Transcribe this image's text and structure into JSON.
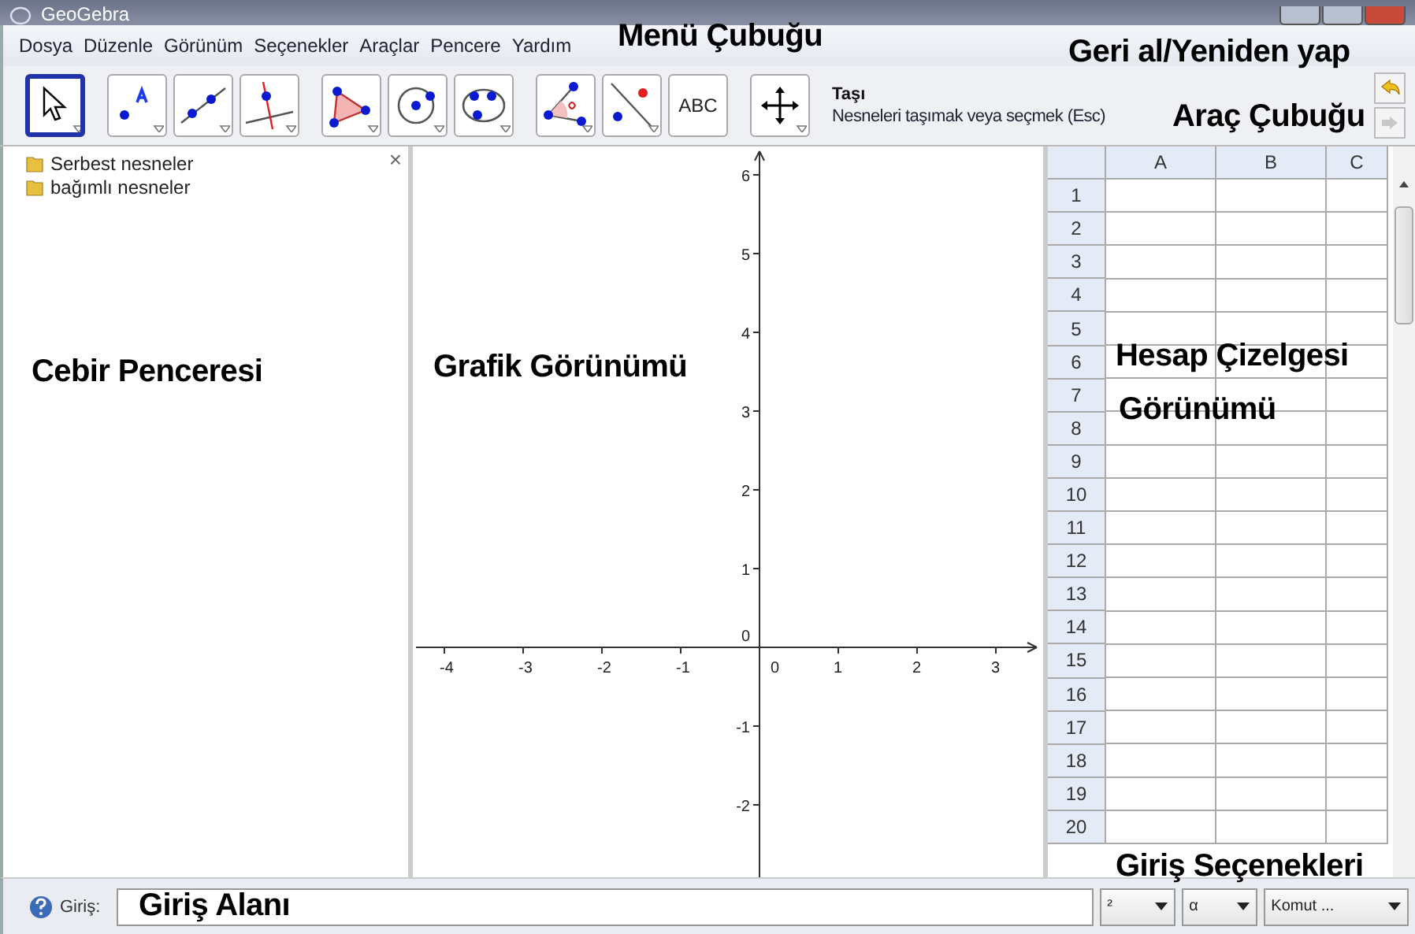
{
  "window": {
    "title": "GeoGebra"
  },
  "menu": [
    "Dosya",
    "Düzenle",
    "Görünüm",
    "Seçenekler",
    "Araçlar",
    "Pencere",
    "Yardım"
  ],
  "toolbar": {
    "tools": [
      {
        "kind": "move",
        "selected": true
      },
      {
        "kind": "point",
        "selected": false
      },
      {
        "kind": "line",
        "selected": false
      },
      {
        "kind": "perpendicular",
        "selected": false
      },
      {
        "kind": "polygon",
        "selected": false
      },
      {
        "kind": "circle",
        "selected": false
      },
      {
        "kind": "conic",
        "selected": false
      },
      {
        "kind": "angle",
        "selected": false
      },
      {
        "kind": "reflect",
        "selected": false
      },
      {
        "kind": "text",
        "label": "ABC",
        "selected": false
      },
      {
        "kind": "pan",
        "selected": false
      }
    ],
    "tool_name": "Taşı",
    "tool_help": "Nesneleri taşımak veya seçmek (Esc)"
  },
  "algebra": {
    "close": "×",
    "items": [
      "Serbest nesneler",
      "bağımlı nesneler"
    ]
  },
  "graphics": {
    "x_labels": [
      "-4",
      "-3",
      "-2",
      "-1",
      "0",
      "1",
      "2",
      "3"
    ],
    "y_labels": [
      "6",
      "5",
      "4",
      "3",
      "2",
      "1",
      "0",
      "-1",
      "-2"
    ]
  },
  "spreadsheet": {
    "columns": [
      "A",
      "B",
      "C"
    ],
    "rows": [
      "1",
      "2",
      "3",
      "4",
      "5",
      "6",
      "7",
      "8",
      "9",
      "10",
      "11",
      "12",
      "13",
      "14",
      "15",
      "16",
      "17",
      "18",
      "19",
      "20"
    ]
  },
  "input_bar": {
    "label": "Giriş:",
    "dropdowns": [
      "²",
      "α",
      "Komut ..."
    ]
  },
  "annotations": [
    "Menü Çubuğu",
    "Geri al/Yeniden yap",
    "Araç Çubuğu",
    "Cebir Penceresi",
    "Grafik Görünümü",
    "Hesap Çizelgesi",
    "Görünümü",
    "Giriş Seçenekleri",
    "Giriş Alanı"
  ]
}
